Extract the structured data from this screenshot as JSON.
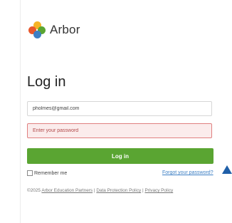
{
  "brand": {
    "name": "Arbor",
    "logo_colors": [
      "#f5b324",
      "#e8572b",
      "#5aa532",
      "#3d7fc4"
    ]
  },
  "login": {
    "title": "Log in",
    "email_value": "pholmes@gmail.com",
    "password_placeholder": "Enter your password",
    "submit_label": "Log in",
    "remember_label": "Remember me",
    "forgot_link": "Forgot your password?"
  },
  "footer": {
    "copyright_prefix": "©2025 ",
    "company_link": "Arbor Education Partners",
    "separator": " | ",
    "data_protection_link": "Data Protection Policy",
    "privacy_link": "Privacy Policy"
  },
  "colors": {
    "accent_green": "#5aa532",
    "link_blue": "#3d7fc4",
    "error_bg": "#fbecec",
    "error_border": "#e08080"
  }
}
